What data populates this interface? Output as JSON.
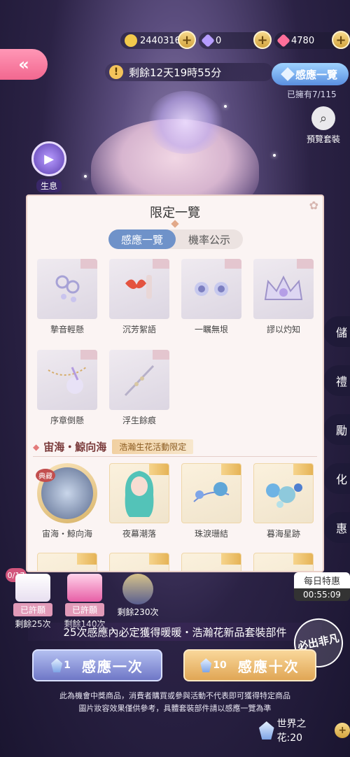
{
  "header": {
    "back_icon": "double-chevron-left-icon",
    "currencies": [
      {
        "name": "gold",
        "value": "24403167",
        "color": "#f2c94c"
      },
      {
        "name": "diamond",
        "value": "0",
        "color": "#b69cff"
      },
      {
        "name": "pink-diamond",
        "value": "4780",
        "color": "#ff6f9a"
      }
    ],
    "timer_text": "剩餘12天19時55分",
    "collection_button": "感應一覽",
    "owned_text": "已擁有7/115",
    "preview_label": "預覽套裝",
    "story_label": "生息"
  },
  "side_menu": [
    "儲",
    "禮",
    "勵",
    "化",
    "惠"
  ],
  "daily_deal": {
    "label": "每日特惠",
    "timer": "00:55:09"
  },
  "modal": {
    "title": "限定一覽",
    "tabs": [
      "感應一覽",
      "機率公示"
    ],
    "limited_items": [
      "摯音輕懸",
      "沉芳絮語",
      "一瞩無垠",
      "謬以灼知",
      "序章倒懸",
      "浮生餘痕"
    ],
    "section": {
      "title": "宙海・鯨向海",
      "badge": "浩瀚生花活動限定"
    },
    "set_items": [
      "宙海・鯨向海",
      "夜幕潮落",
      "珠淚珊結",
      "暮海星跡"
    ],
    "special_tag": "典藏"
  },
  "rewards": {
    "progress": "0/17",
    "items": [
      {
        "status": "已許願",
        "remain": "剩餘25次"
      },
      {
        "status": "已許願",
        "remain": "剩餘140次"
      },
      {
        "status": "",
        "remain": "剩餘230次"
      }
    ]
  },
  "guarantee_text": "25次感應內必定獲得暖暖・浩瀚花新品套裝部件",
  "stamp_text": "必出非凡",
  "draw_one": {
    "count": "1",
    "label": "感應一次"
  },
  "draw_ten": {
    "count": "10",
    "label": "感應十次"
  },
  "disclaimer_1": "此為機會中獎商品，消費者購買或參與活動不代表即可獲得特定商品",
  "disclaimer_2": "圖片妝容效果僅供參考，具體套裝部件請以感應一覽為準",
  "world_flower": "世界之花:20"
}
